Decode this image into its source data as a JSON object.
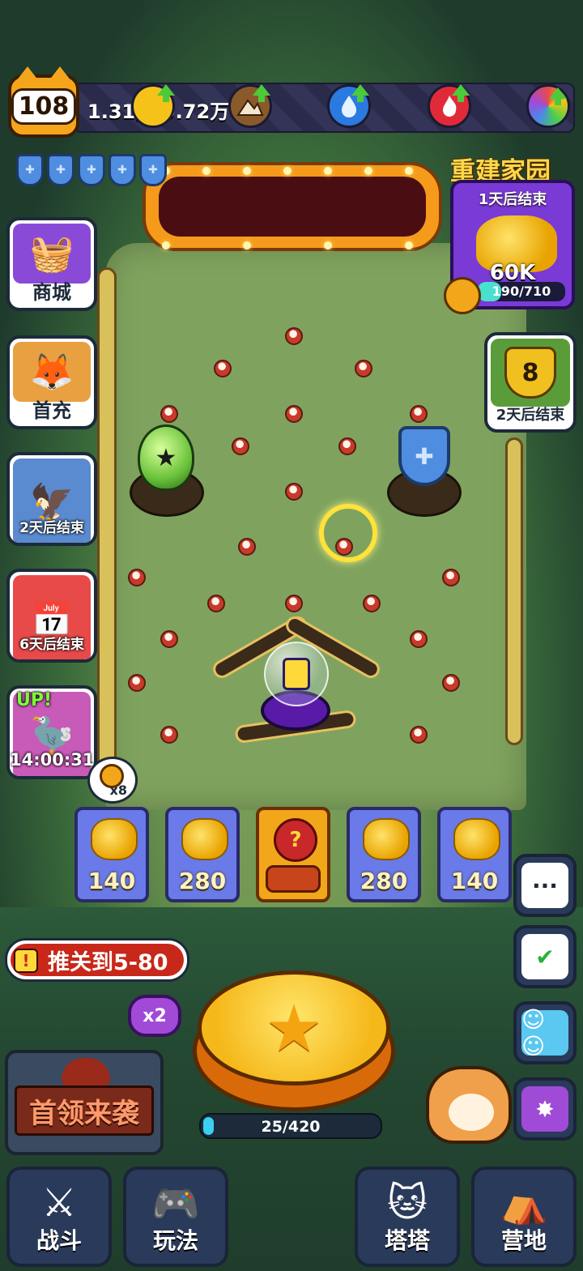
{
  "header": {
    "level": "108",
    "xp": "1.31万/9.72万"
  },
  "left_menu": {
    "shop_label": "商城",
    "first_recharge_label": "首充",
    "event1_timer": "2天后结束",
    "event2_timer": "6天后结束",
    "event3_badge": "UP!",
    "event3_timer": "14:00:31"
  },
  "rebuild_event": {
    "title": "重建家园",
    "ends": "1天后结束",
    "reward": "60K",
    "progress_text": "190/710",
    "progress": 0.268
  },
  "trophy_event": {
    "count": "8",
    "timer": "2天后结束"
  },
  "slots": {
    "key_count": "x8",
    "values": [
      "140",
      "280",
      "?",
      "280",
      "140"
    ]
  },
  "mission": {
    "text": "推关到5-80"
  },
  "multiplier": "x2",
  "energy": {
    "text": "25/420",
    "progress": 0.06
  },
  "boss": {
    "label": "首领来袭"
  },
  "nav": {
    "battle": "战斗",
    "gameplay": "玩法",
    "tata": "塔塔",
    "camp": "营地"
  },
  "icons": {
    "resources": [
      "gold-coin-icon",
      "mountain-icon",
      "water-drop-icon",
      "fire-icon",
      "rainbow-icon"
    ],
    "right_buttons": [
      "chat-icon",
      "task-checklist-icon",
      "friends-icon",
      "cat-badge-icon"
    ]
  },
  "colors": {
    "accent_orange": "#f5a51b",
    "event_purple": "#7a3ad6",
    "mission_red": "#c8281a"
  }
}
